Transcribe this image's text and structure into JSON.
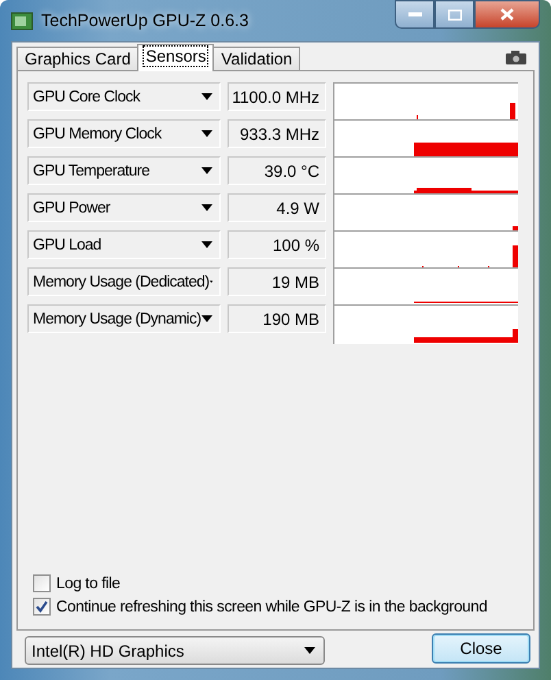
{
  "window": {
    "title": "TechPowerUp GPU-Z 0.6.3"
  },
  "tabs": [
    {
      "label": "Graphics Card",
      "selected": false
    },
    {
      "label": "Sensors",
      "selected": true
    },
    {
      "label": "Validation",
      "selected": false
    }
  ],
  "sensors": [
    {
      "name": "GPU Core Clock",
      "reading": "1100.0 MHz"
    },
    {
      "name": "GPU Memory Clock",
      "reading": "933.3 MHz"
    },
    {
      "name": "GPU Temperature",
      "reading": "39.0 °C"
    },
    {
      "name": "GPU Power",
      "reading": "4.9 W"
    },
    {
      "name": "GPU Load",
      "reading": "100 %"
    },
    {
      "name": "Memory Usage (Dedicated)",
      "reading": "19 MB"
    },
    {
      "name": "Memory Usage (Dynamic)",
      "reading": "190 MB"
    }
  ],
  "options": [
    {
      "label": "Log to file",
      "checked": false
    },
    {
      "label": "Continue refreshing this screen while GPU-Z is in the background",
      "checked": true
    }
  ],
  "adapter": {
    "value": "Intel(R) HD Graphics"
  },
  "buttons": [
    "Close"
  ]
}
